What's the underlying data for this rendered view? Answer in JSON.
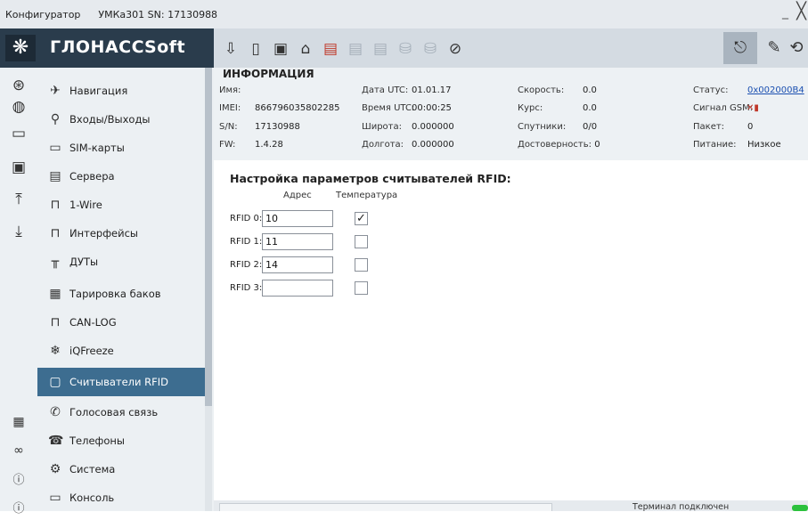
{
  "window": {
    "title": "Конфигуратор",
    "device": "УМКа301 SN: 17130988"
  },
  "logo": {
    "text": "ГЛОНАССSoft"
  },
  "toolbar": {
    "icons": [
      "download-icon",
      "sim-card-icon",
      "memory-card-icon",
      "remote-connect-icon",
      "firmware-icon",
      "firmware-dim-icon",
      "firmware-dim2-icon",
      "database-dim-icon",
      "database-settings-dim-icon",
      "location-clear-icon"
    ],
    "right_icons": [
      "device-connect-icon",
      "usb-connect-icon",
      "exit-icon"
    ]
  },
  "sidebar": {
    "items": [
      {
        "label": "Навигация",
        "icon": "satellite-icon"
      },
      {
        "label": "Входы/Выходы",
        "icon": "io-icon"
      },
      {
        "label": "SIM-карты",
        "icon": "sim-icon"
      },
      {
        "label": "Сервера",
        "icon": "server-icon"
      },
      {
        "label": "1-Wire",
        "icon": "one-wire-icon"
      },
      {
        "label": "Интерфейсы",
        "icon": "interface-icon"
      },
      {
        "label": "ДУТы",
        "icon": "fuel-sensor-icon"
      },
      {
        "label": "Тарировка баков",
        "icon": "tank-icon"
      },
      {
        "label": "CAN-LOG",
        "icon": "can-icon"
      },
      {
        "label": "iQFreeze",
        "icon": "snowflake-icon"
      },
      {
        "label": "Считыватели RFID",
        "icon": "rfid-icon"
      },
      {
        "label": "Голосовая связь",
        "icon": "phone-call-icon"
      },
      {
        "label": "Телефоны",
        "icon": "phone-book-icon"
      },
      {
        "label": "Система",
        "icon": "gear-icon"
      },
      {
        "label": "Консоль",
        "icon": "console-icon"
      }
    ]
  },
  "info": {
    "title": "ИНФОРМАЦИЯ",
    "name_label": "Имя:",
    "name_value": "",
    "imei_label": "IMEI:",
    "imei_value": "866796035802285",
    "sn_label": "S/N:",
    "sn_value": "17130988",
    "fw_label": "FW:",
    "fw_value": "1.4.28",
    "date_label": "Дата UTC:",
    "date_value": "01.01.17",
    "time_label": "Время UTC:",
    "time_value": "00:00:25",
    "lat_label": "Широта:",
    "lat_value": "0.000000",
    "lon_label": "Долгота:",
    "lon_value": "0.000000",
    "speed_label": "Скорость:",
    "speed_value": "0.0",
    "course_label": "Курс:",
    "course_value": "0.0",
    "sats_label": "Спутники:",
    "sats_value": "0/0",
    "valid_label": "Достоверность:",
    "valid_value": "0",
    "status_label": "Статус:",
    "status_value": "0x002000B4",
    "gsm_label": "Сигнал GSM:",
    "packet_label": "Пакет:",
    "packet_value": "0",
    "power_label": "Питание:",
    "power_value": "Низкое"
  },
  "rfid": {
    "title": "Настройка параметров считывателей RFID:",
    "col_address": "Адрес",
    "col_temperature": "Температура",
    "rows": [
      {
        "label": "RFID 0:",
        "address": "10",
        "temperature": true
      },
      {
        "label": "RFID 1:",
        "address": "11",
        "temperature": false
      },
      {
        "label": "RFID 2:",
        "address": "14",
        "temperature": false
      },
      {
        "label": "RFID 3:",
        "address": "",
        "temperature": false
      }
    ]
  },
  "status": {
    "text": "Терминал подключен"
  },
  "colors": {
    "active": "#3d6d90",
    "logo_bg": "#2a3c4c",
    "connected": "#2cc13d"
  }
}
